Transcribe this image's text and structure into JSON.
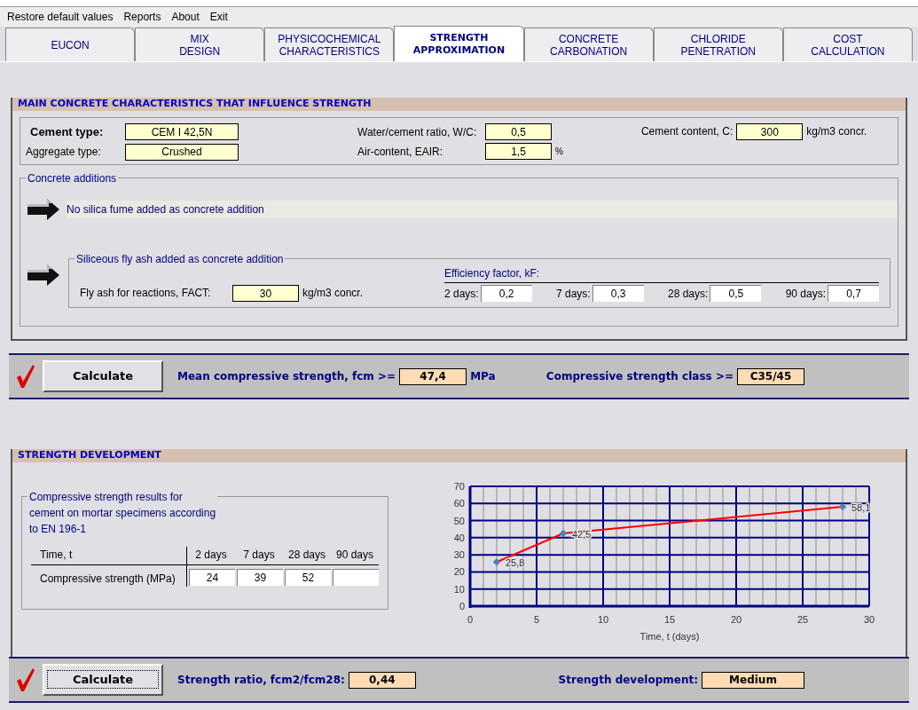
{
  "menu": [
    "Restore default values",
    "Reports",
    "About",
    "Exit"
  ],
  "tabs": [
    {
      "label": "EUCON",
      "selected": false
    },
    {
      "label": "MIX\nDESIGN",
      "selected": false
    },
    {
      "label": "PHYSICOCHEMICAL\nCHARACTERISTICS",
      "selected": false
    },
    {
      "label": "STRENGTH\nAPPROXIMATION",
      "selected": true
    },
    {
      "label": "CONCRETE\nCARBONATION",
      "selected": false
    },
    {
      "label": "CHLORIDE\nPENETRATION",
      "selected": false
    },
    {
      "label": "COST\nCALCULATION",
      "selected": false
    }
  ],
  "main_section": {
    "title": "MAIN CONCRETE CHARACTERISTICS THAT INFLUENCE STRENGTH",
    "cement_type": {
      "label": "Cement type:",
      "value": "CEM I 42,5N"
    },
    "aggregate_type": {
      "label": "Aggregate type:",
      "value": "Crushed"
    },
    "wc_ratio": {
      "label": "Water/cement ratio, W/C:",
      "value": "0,5"
    },
    "air_content": {
      "label": "Air-content, EAIR:",
      "value": "1,5",
      "unit": "%"
    },
    "cement_content": {
      "label": "Cement content, C:",
      "value": "300",
      "unit": "kg/m3 concr."
    },
    "additions": {
      "title": "Concrete additions",
      "silica_fume": "No silica fume added as concrete addition",
      "fly_ash": {
        "title": "Siliceous fly ash added as concrete addition",
        "label": "Fly ash for reactions, FACT:",
        "value": "30",
        "unit": "kg/m3 concr.",
        "efficiency_title": "Efficiency factor, kF:",
        "efficiency": [
          {
            "label": "2 days:",
            "value": "0,2"
          },
          {
            "label": "7 days:",
            "value": "0,3"
          },
          {
            "label": "28 days:",
            "value": "0,5"
          },
          {
            "label": "90 days:",
            "value": "0,7"
          }
        ]
      }
    }
  },
  "result_bar_1": {
    "button": "Calculate",
    "focused": false,
    "results": [
      {
        "label": "Mean compressive strength, fcm >=",
        "value": "47,4",
        "unit": "MPa"
      },
      {
        "label": "Compressive strength class >=",
        "value": "C35/45"
      }
    ]
  },
  "development_section": {
    "title": "STRENGTH DEVELOPMENT",
    "group_title": "Compressive strength results for\ncement on mortar specimens according\nto EN 196-1",
    "table": {
      "columns": [
        "Time, t",
        "2 days",
        "7 days",
        "28 days",
        "90 days"
      ],
      "row_label": "Compressive strength (MPa)",
      "values": [
        "24",
        "39",
        "52"
      ]
    },
    "chart_data": {
      "type": "line",
      "xlabel": "Time, t (days)",
      "x": [
        2,
        7,
        28
      ],
      "series": [
        {
          "color": "#ff0000",
          "marker": true,
          "values": [
            25.8,
            42.5,
            58.1
          ]
        }
      ],
      "grid": true,
      "xlim": [
        0,
        30
      ],
      "ylim": [
        0,
        70
      ],
      "xticks": [
        0,
        5,
        10,
        15,
        20,
        25,
        30
      ],
      "yticks": [
        0,
        10,
        20,
        30,
        40,
        50,
        60,
        70
      ],
      "value_labels": [
        "25,8",
        "42,5",
        "58,1"
      ]
    }
  },
  "result_bar_2": {
    "button": "Calculate",
    "focused": true,
    "results": [
      {
        "label": "Strength ratio, fcm2/fcm28:",
        "value": "0,44"
      },
      {
        "label": "Strength development:",
        "value": "Medium"
      }
    ]
  }
}
